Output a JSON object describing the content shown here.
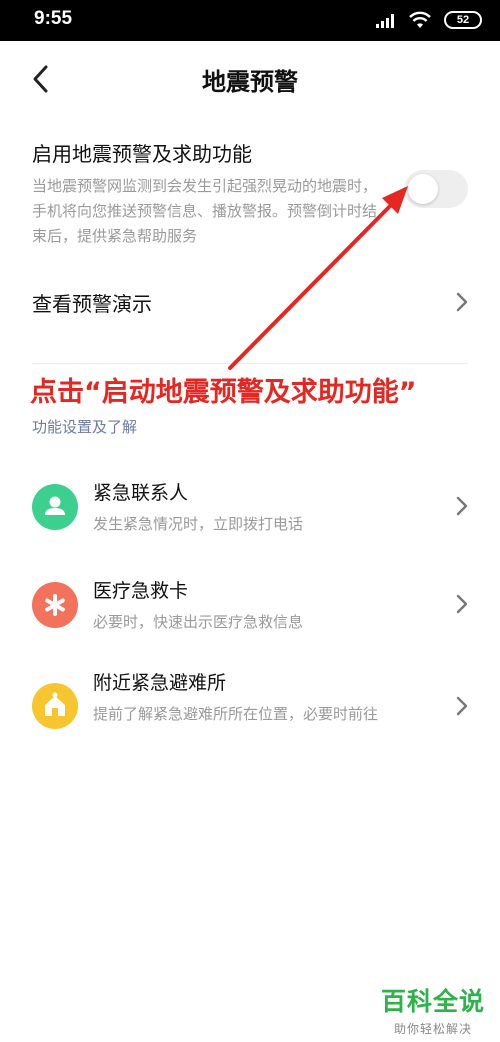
{
  "status_bar": {
    "time": "9:55",
    "battery": "52"
  },
  "header": {
    "title": "地震预警"
  },
  "enable": {
    "title": "启用地震预警及求助功能",
    "description": "当地震预警网监测到会发生引起强烈晃动的地震时，手机将向您推送预警信息、播放警报。预警倒计时结束后，提供紧急帮助服务",
    "toggle_on": false
  },
  "demo": {
    "label": "查看预警演示"
  },
  "annotation": {
    "text": "点击“启动地震预警及求助功能”",
    "color": "#e52621"
  },
  "section": {
    "label": "功能设置及了解"
  },
  "features": [
    {
      "title": "紧急联系人",
      "desc": "发生紧急情况时，立即拨打电话",
      "icon": "contact-icon",
      "color": "#3ccf8e"
    },
    {
      "title": "医疗急救卡",
      "desc": "必要时，快速出示医疗急救信息",
      "icon": "medical-icon",
      "color": "#f2725c"
    },
    {
      "title": "附近紧急避难所",
      "desc": "提前了解紧急避难所所在位置，必要时前往",
      "icon": "shelter-icon",
      "color": "#f7c52e"
    }
  ],
  "watermark": {
    "title": "百科全说",
    "subtitle": "助你轻松解决"
  }
}
